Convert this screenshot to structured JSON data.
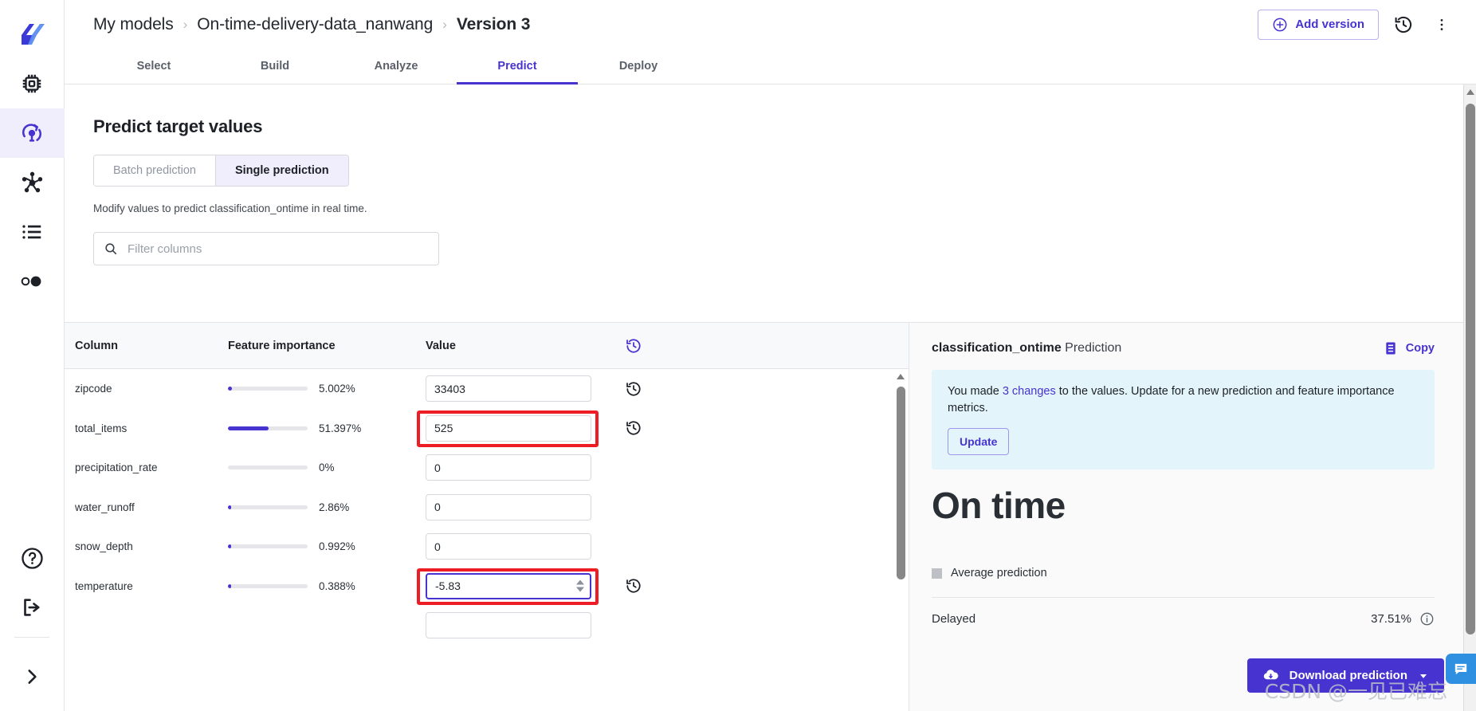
{
  "sidebar": {
    "items": [
      {
        "name": "app-logo",
        "icon": "logo-icon",
        "active": false
      },
      {
        "name": "sidebar-item-catalog",
        "icon": "chip-icon",
        "active": false
      },
      {
        "name": "sidebar-item-machine-learning",
        "icon": "model-insight-icon",
        "active": true
      },
      {
        "name": "sidebar-item-pipelines",
        "icon": "hub-network-icon",
        "active": false
      },
      {
        "name": "sidebar-item-jobs",
        "icon": "list-icon",
        "active": false
      },
      {
        "name": "sidebar-item-monitoring",
        "icon": "circles-icon",
        "active": false
      }
    ],
    "bottom": [
      {
        "name": "sidebar-item-help",
        "icon": "help-circle-icon"
      },
      {
        "name": "sidebar-item-logout",
        "icon": "logout-icon"
      },
      {
        "name": "sidebar-expand-button",
        "icon": "chevron-right-icon"
      }
    ]
  },
  "header": {
    "breadcrumb": [
      {
        "label": "My models",
        "current": false
      },
      {
        "label": "On-time-delivery-data_nanwang",
        "current": false
      },
      {
        "label": "Version 3",
        "current": true
      }
    ],
    "separator": "›",
    "add_version_label": "Add version",
    "history_icon": "history-icon",
    "more_icon": "more-vertical-icon"
  },
  "tabs": [
    {
      "label": "Select",
      "active": false
    },
    {
      "label": "Build",
      "active": false
    },
    {
      "label": "Analyze",
      "active": false
    },
    {
      "label": "Predict",
      "active": true
    },
    {
      "label": "Deploy",
      "active": false
    }
  ],
  "main": {
    "section_title": "Predict target values",
    "segmented": [
      {
        "label": "Batch prediction",
        "active": false
      },
      {
        "label": "Single prediction",
        "active": true
      }
    ],
    "subtitle": "Modify values to predict classification_ontime in real time.",
    "filter_placeholder": "Filter columns",
    "filter_value": ""
  },
  "table": {
    "headers": {
      "column": "Column",
      "importance": "Feature importance",
      "value": "Value",
      "reset_icon": "history-reset-icon"
    },
    "rows": [
      {
        "column": "zipcode",
        "importance_pct": 5.002,
        "importance_label": "5.002%",
        "value": "33403",
        "has_reset": true,
        "highlighted": false,
        "focused": false,
        "spinner": false
      },
      {
        "column": "total_items",
        "importance_pct": 51.397,
        "importance_label": "51.397%",
        "value": "525",
        "has_reset": true,
        "highlighted": true,
        "focused": false,
        "spinner": false
      },
      {
        "column": "precipitation_rate",
        "importance_pct": 0,
        "importance_label": "0%",
        "value": "0",
        "has_reset": false,
        "highlighted": false,
        "focused": false,
        "spinner": false
      },
      {
        "column": "water_runoff",
        "importance_pct": 2.86,
        "importance_label": "2.86%",
        "value": "0",
        "has_reset": false,
        "highlighted": false,
        "focused": false,
        "spinner": false
      },
      {
        "column": "snow_depth",
        "importance_pct": 0.992,
        "importance_label": "0.992%",
        "value": "0",
        "has_reset": false,
        "highlighted": false,
        "focused": false,
        "spinner": false
      },
      {
        "column": "temperature",
        "importance_pct": 0.388,
        "importance_label": "0.388%",
        "value": "-5.83",
        "has_reset": true,
        "highlighted": true,
        "focused": true,
        "spinner": true
      }
    ]
  },
  "prediction": {
    "target_name": "classification_ontime",
    "title_suffix": " Prediction",
    "copy_label": "Copy",
    "copy_icon": "copy-icon",
    "notice_prefix": "You made ",
    "notice_link": "3 changes",
    "notice_suffix": " to the values. Update for a new prediction and feature importance metrics.",
    "update_label": "Update",
    "result": "On time",
    "average_prediction_label": "Average prediction",
    "classes": [
      {
        "label": "Delayed",
        "percent": "37.51%",
        "info_icon": "info-icon"
      }
    ]
  },
  "footer": {
    "download_label": "Download prediction",
    "download_icon": "cloud-download-icon",
    "caret_icon": "caret-down-icon",
    "chat_icon": "chat-icon",
    "watermark": "CSDN @一见已难忘"
  },
  "colors": {
    "accent": "#4633d0",
    "highlight": "#ee1c24",
    "notice_bg": "#e3f5fb",
    "bar_track": "#e6e6ea"
  }
}
